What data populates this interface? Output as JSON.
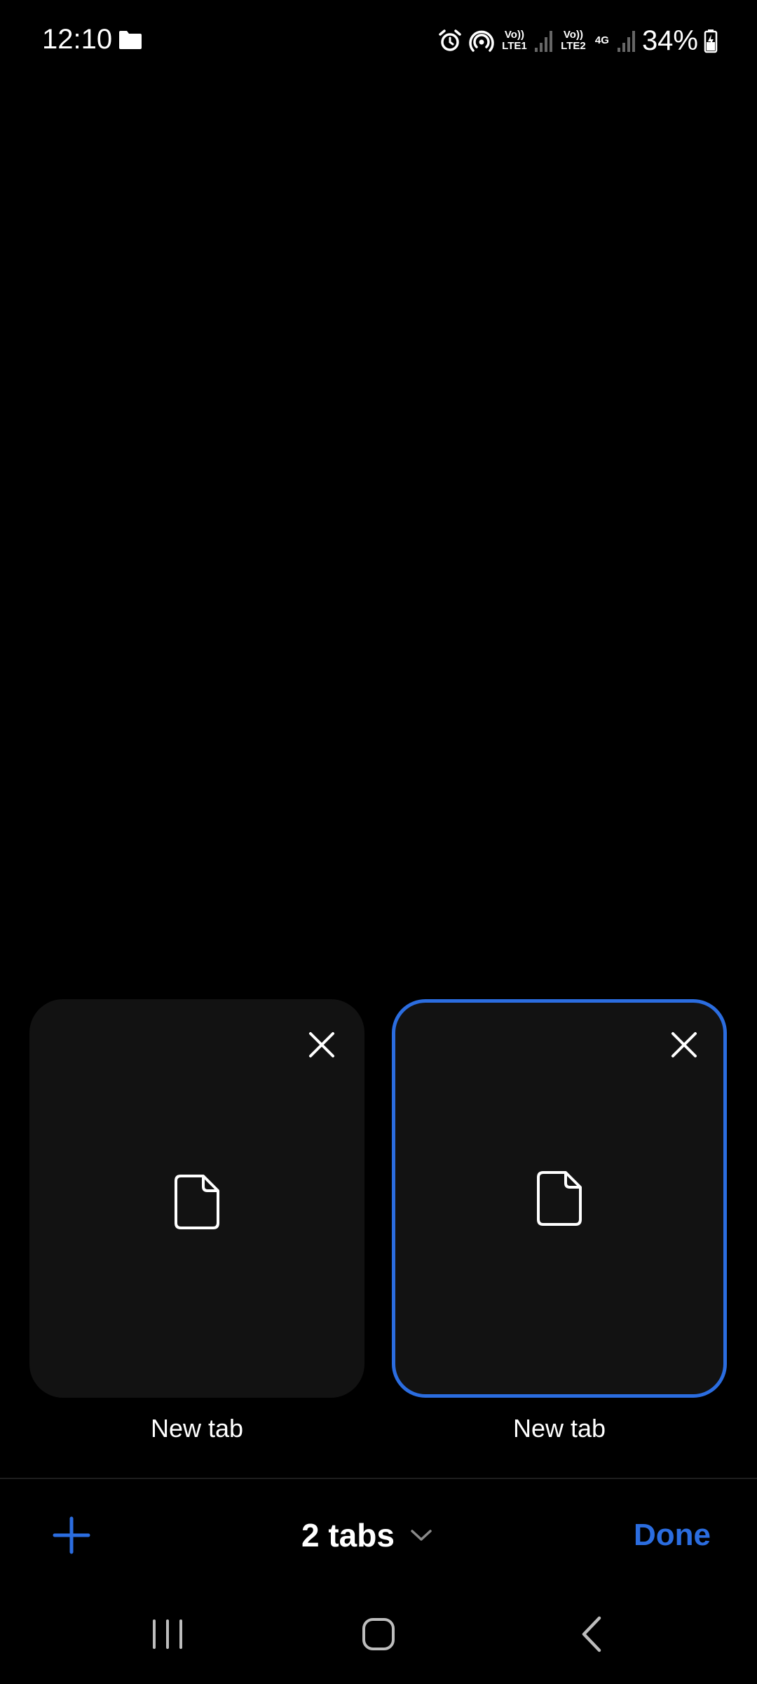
{
  "status_bar": {
    "time": "12:10",
    "network": {
      "sim1": "Vo)) LTE1",
      "sim2": "Vo)) LTE2",
      "data_type": "4G"
    },
    "battery_percent": "34%",
    "icons": [
      "folder-icon",
      "alarm-icon",
      "hotspot-icon",
      "signal-icon",
      "battery-charging-icon"
    ]
  },
  "tabs": [
    {
      "title": "New tab",
      "active": false
    },
    {
      "title": "New tab",
      "active": true
    }
  ],
  "toolbar": {
    "tab_count_label": "2 tabs",
    "done_label": "Done",
    "icons": [
      "plus-icon",
      "chevron-down-icon"
    ]
  },
  "nav_bar": {
    "icons": [
      "recents-icon",
      "home-icon",
      "back-icon"
    ]
  },
  "colors": {
    "background": "#000000",
    "card_background": "#121212",
    "accent": "#2b6de0",
    "text": "#ffffff"
  }
}
